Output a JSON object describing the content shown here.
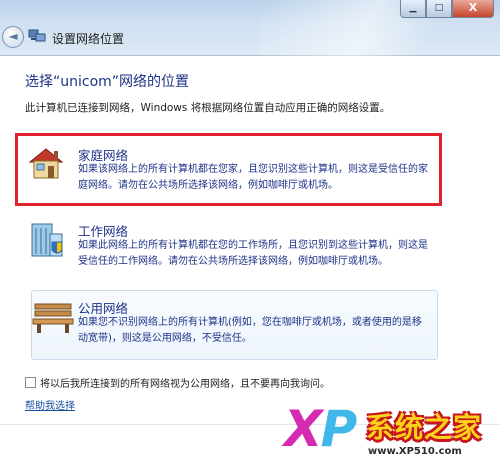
{
  "window": {
    "title": "设置网络位置",
    "buttons": {
      "minimize": "▁",
      "maximize": "□",
      "close": "X"
    }
  },
  "page": {
    "heading": "选择“unicom”网络的位置",
    "intro": "此计算机已连接到网络，Windows 将根据网络位置自动应用正确的网络设置。"
  },
  "options": [
    {
      "title": "家庭网络",
      "icon": "house-icon",
      "desc": "如果该网络上的所有计算机都在您家，且您识别这些计算机，则这是受信任的家庭网络。请勿在公共场所选择该网络，例如咖啡厅或机场。",
      "selected": true
    },
    {
      "title": "工作网络",
      "icon": "office-building-icon",
      "desc": "如果此网络上的所有计算机都在您的工作场所，且您识别到这些计算机，则这是受信任的工作网络。请勿在公共场所选择该网络，例如咖啡厅或机场。"
    },
    {
      "title": "公用网络",
      "icon": "park-bench-icon",
      "desc": "如果您不识别网络上的所有计算机(例如，您在咖啡厅或机场，或者使用的是移动宽带)，则这是公用网络，不受信任。",
      "hovered": true
    }
  ],
  "checkbox": {
    "label": "将以后我所连接到的所有网络视为公用网络，且不要再向我询问。",
    "checked": false
  },
  "help_link": "帮助我选择",
  "watermark": {
    "xp": "XP",
    "cn": "系统之家",
    "url": "www.XP510.com"
  },
  "colors": {
    "heading": "#1e3287",
    "selection": "#e0222e",
    "chrome": "#b9d1ea"
  }
}
